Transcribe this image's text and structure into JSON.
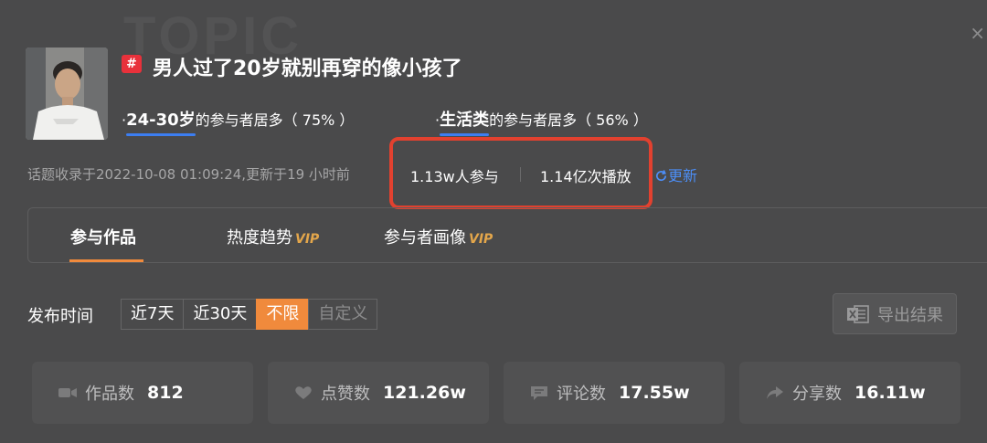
{
  "watermark": "TOPIC",
  "close_icon": "×",
  "topic": {
    "badge": "#",
    "title": "男人过了20岁就别再穿的像小孩了",
    "age_stat": {
      "highlight": "24-30岁",
      "suffix": "的参与者居多（ 75% ）"
    },
    "category_stat": {
      "highlight": "生活类",
      "suffix": "的参与者居多（ 56% ）"
    },
    "meta": "话题收录于2022-10-08 01:09:24,更新于19 小时前",
    "participants": "1.13w人参与",
    "plays": "1.14亿次播放",
    "refresh_label": "更新"
  },
  "tabs": [
    {
      "label": "参与作品",
      "vip": ""
    },
    {
      "label": "热度趋势",
      "vip": "VIP"
    },
    {
      "label": "参与者画像",
      "vip": "VIP"
    }
  ],
  "filter": {
    "label": "发布时间",
    "options": [
      "近7天",
      "近30天",
      "不限",
      "自定义"
    ],
    "selected": "不限"
  },
  "export_label": "导出结果",
  "stats": [
    {
      "icon": "video-icon",
      "label": "作品数",
      "value": "812"
    },
    {
      "icon": "heart-icon",
      "label": "点赞数",
      "value": "121.26w"
    },
    {
      "icon": "comment-icon",
      "label": "评论数",
      "value": "17.55w"
    },
    {
      "icon": "share-icon",
      "label": "分享数",
      "value": "16.11w"
    }
  ],
  "colors": {
    "background": "#4a4a4b",
    "accent_orange": "#f08a3c",
    "link_blue": "#4c8ef7",
    "highlight_red": "#e2412f",
    "badge_red": "#e8313b"
  }
}
